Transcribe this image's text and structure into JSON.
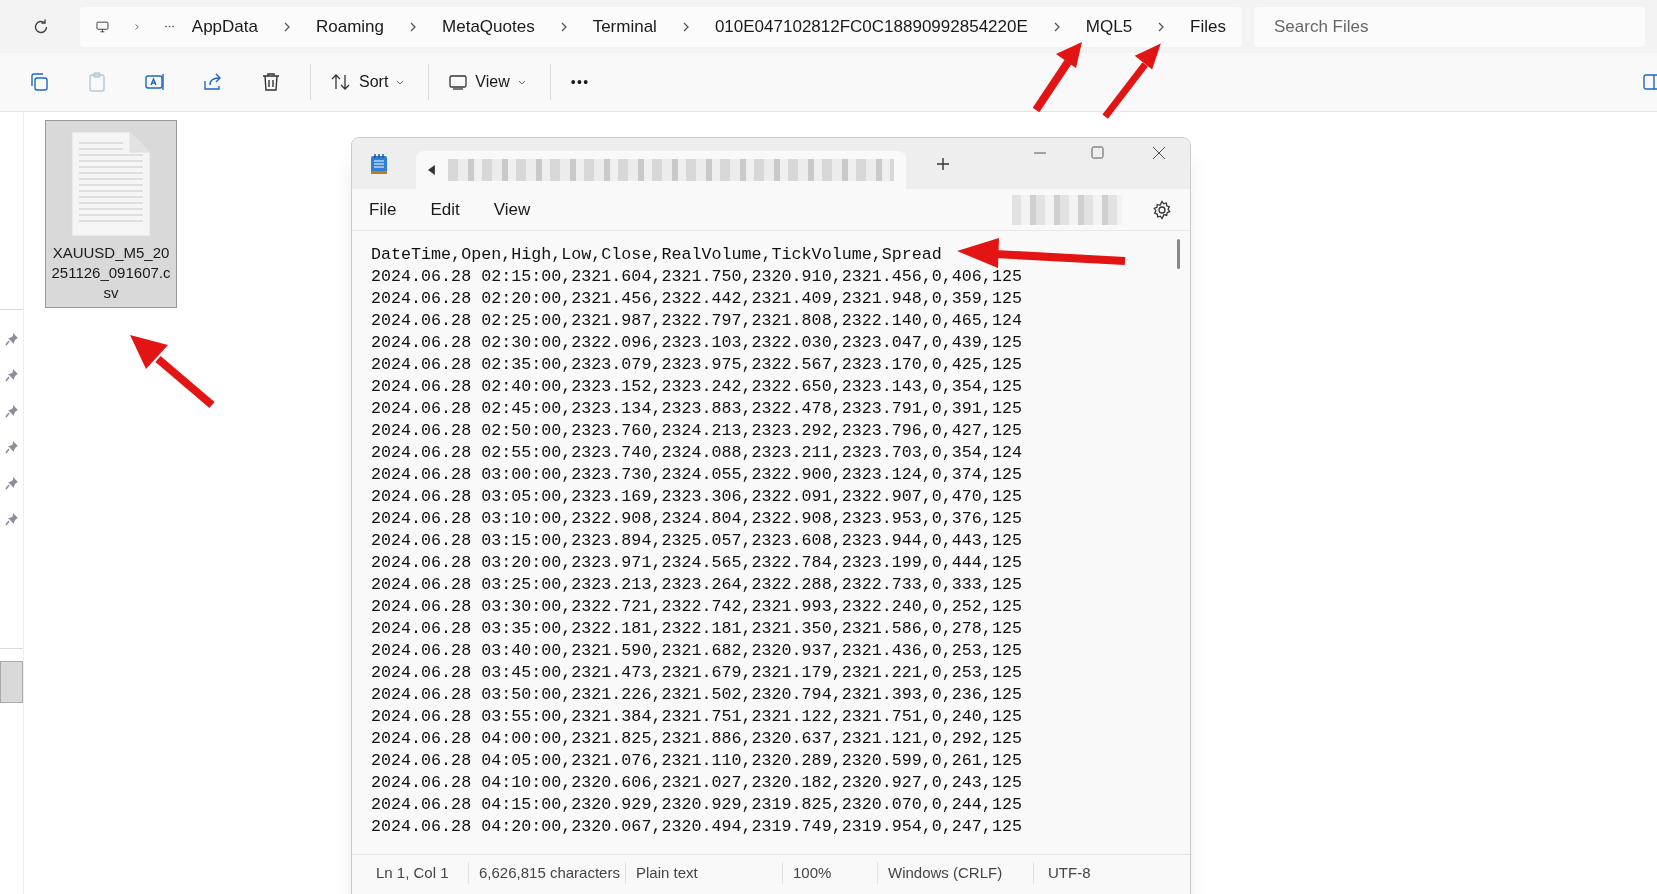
{
  "explorer": {
    "breadcrumb": [
      "AppData",
      "Roaming",
      "MetaQuotes",
      "Terminal",
      "010E047102812FC0C18890992854220E",
      "MQL5",
      "Files"
    ],
    "search": {
      "placeholder": "Search Files"
    },
    "toolbar": {
      "sort": "Sort",
      "view": "View",
      "more": "•••"
    },
    "files": [
      {
        "name": "XAUUSD_M5_20251126_091607.csv",
        "selected": true
      }
    ]
  },
  "notepad": {
    "menu": [
      "File",
      "Edit",
      "View"
    ],
    "lines": [
      "DateTime,Open,High,Low,Close,RealVolume,TickVolume,Spread",
      "2024.06.28 02:15:00,2321.604,2321.750,2320.910,2321.456,0,406,125",
      "2024.06.28 02:20:00,2321.456,2322.442,2321.409,2321.948,0,359,125",
      "2024.06.28 02:25:00,2321.987,2322.797,2321.808,2322.140,0,465,124",
      "2024.06.28 02:30:00,2322.096,2323.103,2322.030,2323.047,0,439,125",
      "2024.06.28 02:35:00,2323.079,2323.975,2322.567,2323.170,0,425,125",
      "2024.06.28 02:40:00,2323.152,2323.242,2322.650,2323.143,0,354,125",
      "2024.06.28 02:45:00,2323.134,2323.883,2322.478,2323.791,0,391,125",
      "2024.06.28 02:50:00,2323.760,2324.213,2323.292,2323.796,0,427,125",
      "2024.06.28 02:55:00,2323.740,2324.088,2323.211,2323.703,0,354,124",
      "2024.06.28 03:00:00,2323.730,2324.055,2322.900,2323.124,0,374,125",
      "2024.06.28 03:05:00,2323.169,2323.306,2322.091,2322.907,0,470,125",
      "2024.06.28 03:10:00,2322.908,2324.804,2322.908,2323.953,0,376,125",
      "2024.06.28 03:15:00,2323.894,2325.057,2323.608,2323.944,0,443,125",
      "2024.06.28 03:20:00,2323.971,2324.565,2322.784,2323.199,0,444,125",
      "2024.06.28 03:25:00,2323.213,2323.264,2322.288,2322.733,0,333,125",
      "2024.06.28 03:30:00,2322.721,2322.742,2321.993,2322.240,0,252,125",
      "2024.06.28 03:35:00,2322.181,2322.181,2321.350,2321.586,0,278,125",
      "2024.06.28 03:40:00,2321.590,2321.682,2320.937,2321.436,0,253,125",
      "2024.06.28 03:45:00,2321.473,2321.679,2321.179,2321.221,0,253,125",
      "2024.06.28 03:50:00,2321.226,2321.502,2320.794,2321.393,0,236,125",
      "2024.06.28 03:55:00,2321.384,2321.751,2321.122,2321.751,0,240,125",
      "2024.06.28 04:00:00,2321.825,2321.886,2320.637,2321.121,0,292,125",
      "2024.06.28 04:05:00,2321.076,2321.110,2320.289,2320.599,0,261,125",
      "2024.06.28 04:10:00,2320.606,2321.027,2320.182,2320.927,0,243,125",
      "2024.06.28 04:15:00,2320.929,2320.929,2319.825,2320.070,0,244,125",
      "2024.06.28 04:20:00,2320.067,2320.494,2319.749,2319.954,0,247,125"
    ],
    "status": [
      "Ln 1, Col 1",
      "6,626,815 characters",
      "Plain text",
      "100%",
      "Windows (CRLF)",
      "UTF-8"
    ]
  }
}
